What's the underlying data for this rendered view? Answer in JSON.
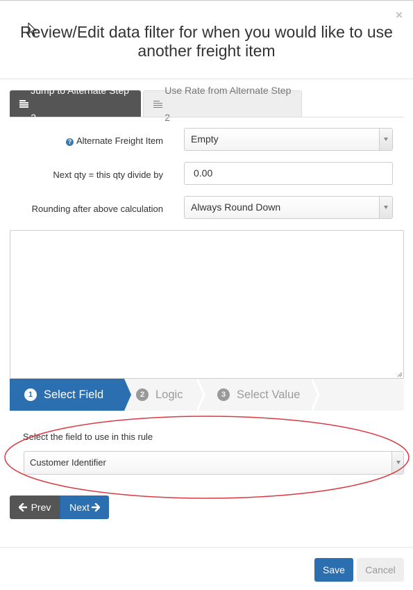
{
  "modal": {
    "title": "Review/Edit data filter for when you would like to use another freight item",
    "close_glyph": "×"
  },
  "tabs": [
    {
      "label": "Jump to Alternate Step 2",
      "icon": "list-lines-icon",
      "active": true
    },
    {
      "label": "Use Rate from Alternate Step 2",
      "icon": "list-lines-icon",
      "active": false
    }
  ],
  "form": {
    "alternate_freight_item": {
      "label": "Alternate Freight Item",
      "value": "Empty",
      "icon": "question-circle-icon"
    },
    "next_qty": {
      "label": "Next qty = this qty divide by",
      "value": "0.00"
    },
    "rounding": {
      "label": "Rounding after above calculation",
      "value": "Always Round Down"
    }
  },
  "wizard": {
    "steps": [
      {
        "number": "1",
        "label": "Select Field",
        "active": true
      },
      {
        "number": "2",
        "label": "Logic",
        "active": false
      },
      {
        "number": "3",
        "label": "Select Value",
        "active": false
      }
    ]
  },
  "field_picker": {
    "label": "Select the field to use in this rule",
    "value": "Customer Identifier"
  },
  "nav": {
    "prev_label": "Prev",
    "next_label": "Next"
  },
  "footer": {
    "save_label": "Save",
    "cancel_label": "Cancel"
  },
  "colors": {
    "primary": "#2b6fb0",
    "dark": "#555555",
    "highlight_ellipse": "#d9393f"
  }
}
